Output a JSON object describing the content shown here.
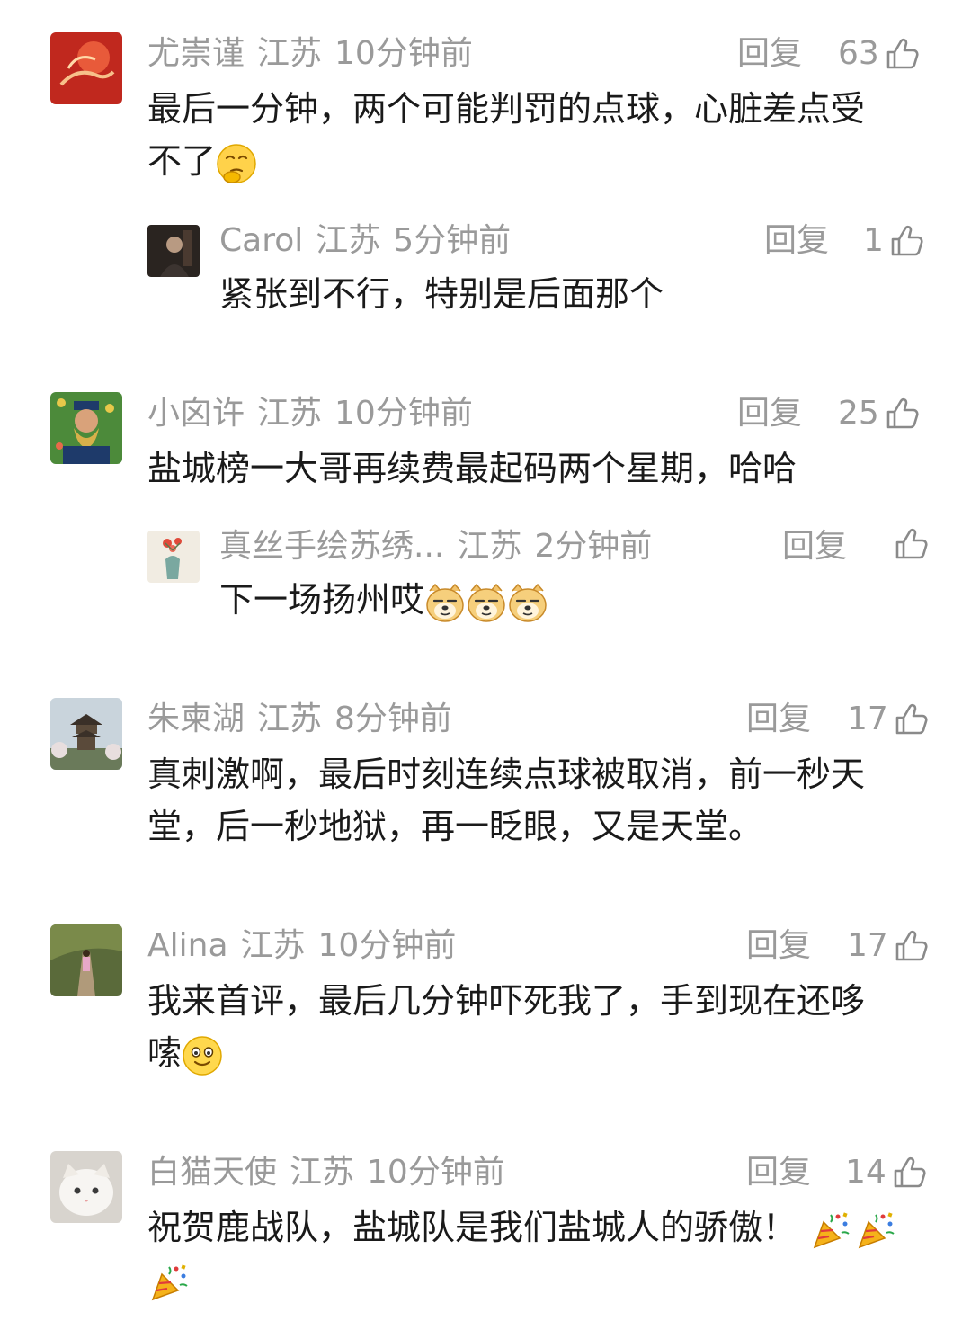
{
  "comments": [
    {
      "username": "尤崇谨",
      "region": "江苏",
      "time": "10分钟前",
      "reply_label": "回复",
      "likes": "63",
      "line1": "最后一分钟，两个可能判罚的点球，心脏差点受",
      "line2": "不了",
      "reply": {
        "username": "Carol",
        "region": "江苏",
        "time": "5分钟前",
        "reply_label": "回复",
        "likes": "1",
        "text": "紧张到不行，特别是后面那个"
      }
    },
    {
      "username": "小囟许",
      "region": "江苏",
      "time": "10分钟前",
      "reply_label": "回复",
      "likes": "25",
      "line1": "盐城榜一大哥再续费最起码两个星期，哈哈",
      "reply": {
        "username": "真丝手绘苏绣...",
        "region": "江苏",
        "time": "2分钟前",
        "reply_label": "回复",
        "likes": "",
        "text": "下一场扬州哎"
      }
    },
    {
      "username": "朱柬湖",
      "region": "江苏",
      "time": "8分钟前",
      "reply_label": "回复",
      "likes": "17",
      "line1": "真刺激啊，最后时刻连续点球被取消，前一秒天",
      "line2": "堂，后一秒地狱，再一眨眼，又是天堂。"
    },
    {
      "username": "Alina",
      "region": "江苏",
      "time": "10分钟前",
      "reply_label": "回复",
      "likes": "17",
      "line1": "我来首评，最后几分钟吓死我了，手到现在还哆",
      "line2": "嗦"
    },
    {
      "username": "白猫天使",
      "region": "江苏",
      "time": "10分钟前",
      "reply_label": "回复",
      "likes": "14",
      "line1": "祝贺鹿战队，盐城队是我们盐城人的骄傲！"
    }
  ]
}
